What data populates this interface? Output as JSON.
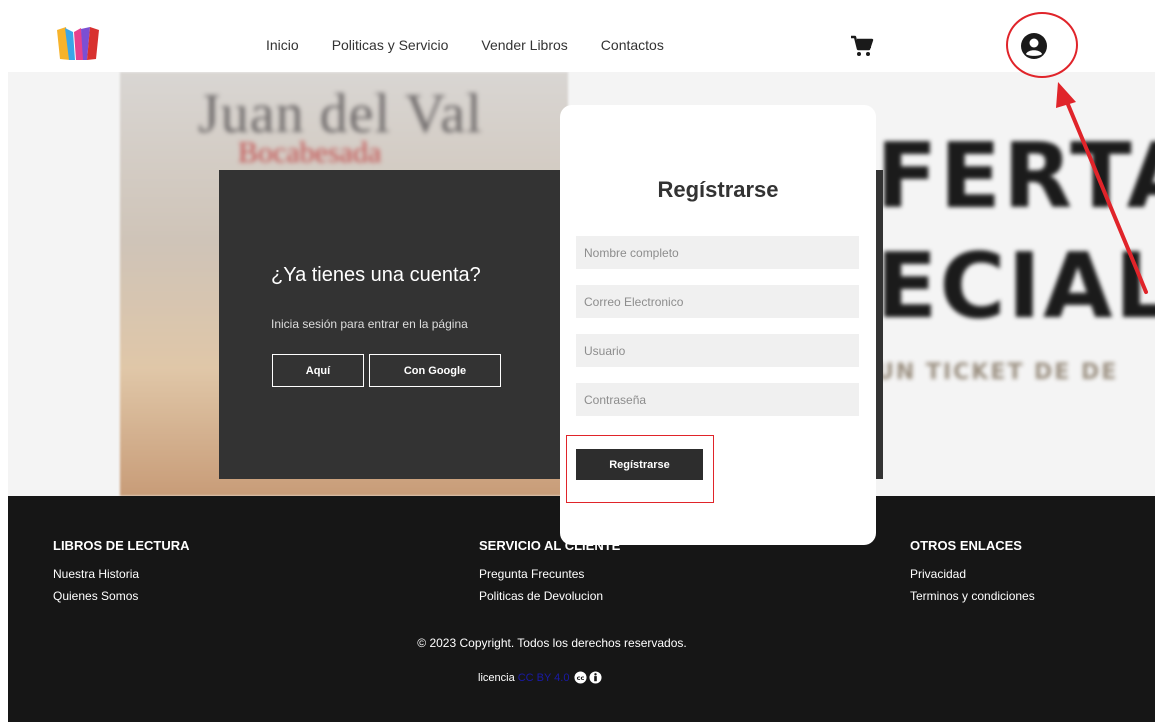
{
  "header": {
    "nav": [
      "Inicio",
      "Politicas y Servicio",
      "Vender Libros",
      "Contactos"
    ],
    "logo_colors": [
      "#f7b32b",
      "#3aa6e8",
      "#e8418b",
      "#7b4fd3"
    ],
    "icons": {
      "cart": "shopping-cart-icon",
      "user": "user-circle-icon"
    }
  },
  "banner": {
    "cover_author": "Juan del Val",
    "cover_subtitle": "Bocabesada",
    "promo_line1": "FERTA",
    "promo_line2": "ECIAL",
    "promo_line3": "UN TICKET DE DE"
  },
  "login_panel": {
    "title": "¿Ya tienes una cuenta?",
    "subtitle": "Inicia sesión para entrar en la página",
    "button_aqui": "Aquí",
    "button_google": "Con Google"
  },
  "register": {
    "title": "Regístrarse",
    "fields": {
      "name_placeholder": "Nombre completo",
      "email_placeholder": "Correo Electronico",
      "user_placeholder": "Usuario",
      "password_placeholder": "Contraseña"
    },
    "button": "Regístrarse"
  },
  "footer": {
    "col1": {
      "title": "LIBROS DE LECTURA",
      "links": [
        "Nuestra Historia",
        "Quienes Somos"
      ]
    },
    "col2": {
      "title": "SERVICIO AL CLIENTE",
      "links": [
        "Pregunta Frecuntes",
        "Politicas de Devolucion"
      ]
    },
    "col3": {
      "title": "OTROS ENLACES",
      "links": [
        "Privacidad",
        "Terminos y condiciones"
      ]
    },
    "copyright": "© 2023 Copyright. Todos los derechos reservados.",
    "license_label": "licencia",
    "license_link": "CC BY 4.0"
  },
  "colors": {
    "annotation": "#e0242a",
    "panel": "#333333",
    "footer": "#161616"
  }
}
